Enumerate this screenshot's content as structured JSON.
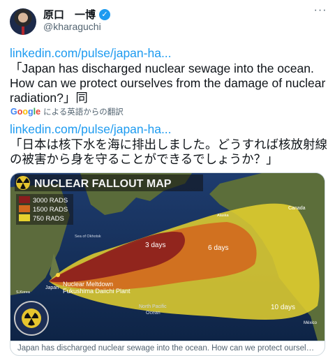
{
  "user": {
    "display_name": "原口　一博",
    "handle": "@kharaguchi"
  },
  "tweet": {
    "link1": "linkedin.com/pulse/japan-ha...",
    "quote1": "「Japan has discharged nuclear sewage into the ocean. How can we protect ourselves from the damage of nuclear radiation?」同",
    "translation_label": "による英語からの翻訳",
    "link2": "linkedin.com/pulse/japan-ha...",
    "quote2": "「日本は核下水を海に排出しました。どうすれば核放射線の被害から身を守ることができるでしょうか？」"
  },
  "card": {
    "map_title": "NUCLEAR FALLOUT MAP",
    "legend": [
      {
        "label": "3000 RADS",
        "color": "#8a1d1d"
      },
      {
        "label": "1500 RADS",
        "color": "#d2691e"
      },
      {
        "label": "750 RADS",
        "color": "#e6d22e"
      }
    ],
    "labels": {
      "three_days": "3 days",
      "six_days": "6 days",
      "ten_days": "10 days",
      "meltdown_1": "Nuclear Meltdown",
      "meltdown_2": "Fukushima Daiichi Plant",
      "japan": "Japan",
      "canada": "Canada",
      "pacific_1": "North Pacific",
      "pacific_2": "Ocean",
      "mexico": "México",
      "sea_okhotsk": "Sea of Okhotsk",
      "alaska": "Alaska",
      "korea": "S.Korea"
    },
    "caption": "Japan has discharged nuclear sewage into the ocean. How can we protect ourselves from the damage of nuclear radiation?"
  }
}
